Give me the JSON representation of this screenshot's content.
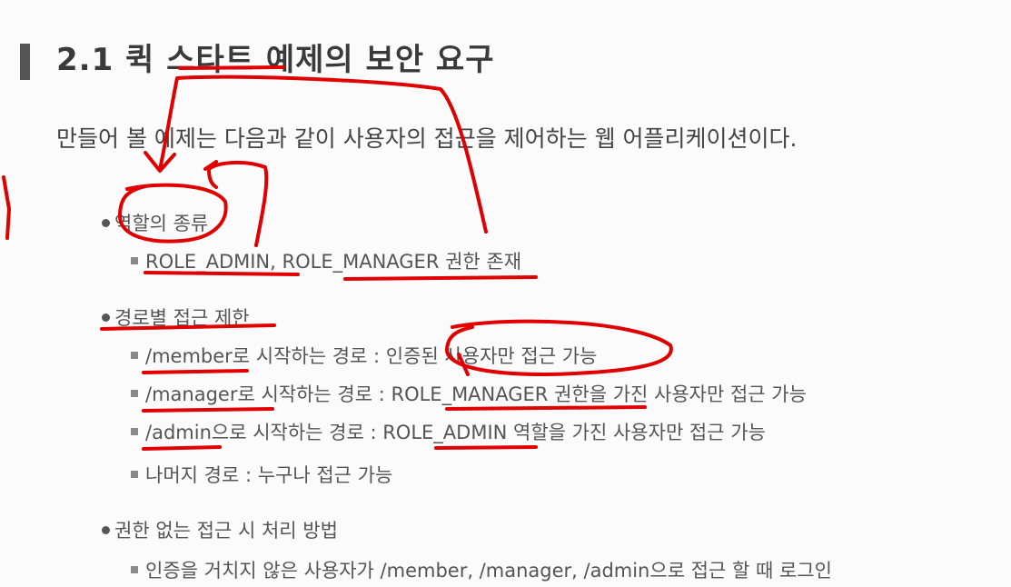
{
  "title": "2.1 퀵 스타트 예제의 보안 요구",
  "intro": "만들어 볼 예제는 다음과 같이 사용자의 접근을 제어하는 웹 어플리케이션이다.",
  "sections": [
    {
      "heading": "역할의 종류",
      "items": [
        "ROLE_ADMIN, ROLE_MANAGER 권한 존재"
      ]
    },
    {
      "heading": "경로별 접근 제한",
      "items": [
        "/member로 시작하는 경로 : 인증된 사용자만 접근 가능",
        "/manager로 시작하는 경로 : ROLE_MANAGER 권한을 가진 사용자만 접근 가능",
        "/admin으로 시작하는 경로 : ROLE_ADMIN 역할을 가진 사용자만 접근 가능",
        "나머지 경로 : 누구나 접근 가능"
      ]
    },
    {
      "heading": "권한 없는 접근 시 처리 방법",
      "items": [
        "인증을 거치지 않은 사용자가 /member, /manager, /admin으로 접근 할 때 로그인"
      ]
    }
  ],
  "colors": {
    "annotation": "#e00000",
    "text": "#555555",
    "background": "#fbfbfb"
  }
}
